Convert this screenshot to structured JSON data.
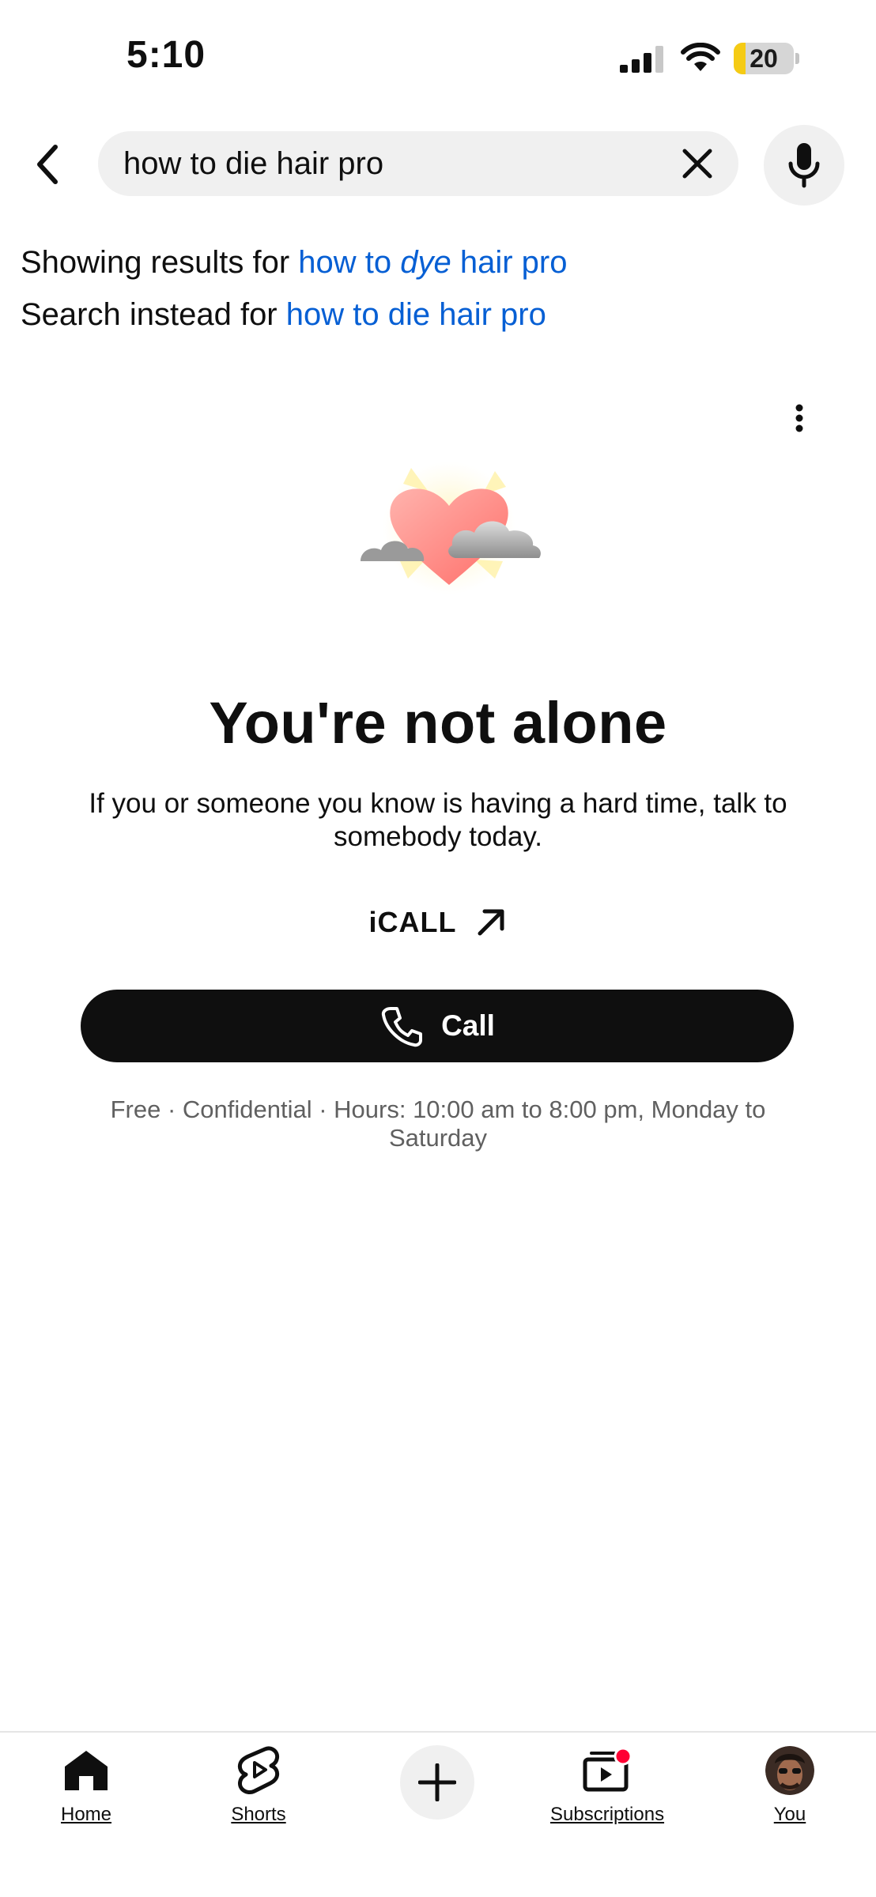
{
  "status_bar": {
    "time": "5:10",
    "battery_percent": "20",
    "battery_level": 0.2,
    "battery_color": "#f5cb14"
  },
  "search": {
    "query": "how to die hair pro",
    "back_icon": "chevron-left-icon",
    "clear_icon": "close-icon",
    "mic_icon": "microphone-icon"
  },
  "correction": {
    "showing_prefix": "Showing results for",
    "corrected_before": "how to ",
    "corrected_word": "dye",
    "corrected_after": " hair pro",
    "instead_prefix": "Search instead for",
    "original_query": "how to die hair pro",
    "link_color": "#065fd4"
  },
  "crisis_panel": {
    "illustration_icon": "heart-with-clouds-icon",
    "headline": "You're not alone",
    "message": "If you or someone you know is having a hard time, talk to somebody today.",
    "provider": "iCALL",
    "provider_link_icon": "arrow-up-right-icon",
    "call_button": "Call",
    "call_icon": "phone-icon",
    "details": "Free · Confidential · Hours: 10:00 am to 8:00 pm, Monday to Saturday",
    "more_icon": "more-vertical-icon"
  },
  "bottom_nav": {
    "home": "Home",
    "shorts": "Shorts",
    "create_icon": "plus-icon",
    "subscriptions": "Subscriptions",
    "you": "You",
    "notification_dot_color": "#ff0033"
  }
}
